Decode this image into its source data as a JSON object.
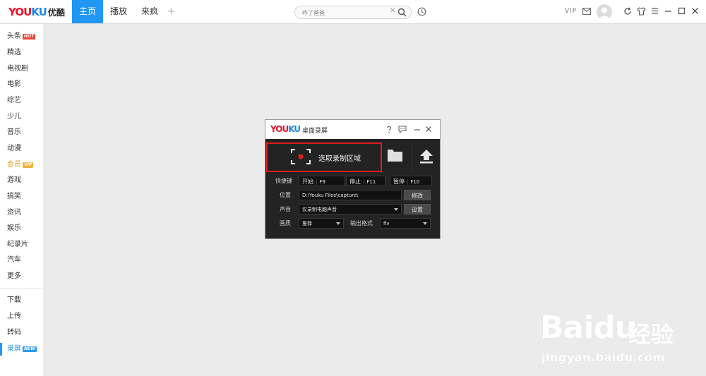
{
  "brand": {
    "logo_word": "YOUKU",
    "logo_cn": "优酷",
    "accent": "#2196f3",
    "logo_red": "#e8132b",
    "logo_blue": "#1e88e5"
  },
  "topnav": {
    "tabs": [
      {
        "label": "主页",
        "active": true
      },
      {
        "label": "播放",
        "active": false
      },
      {
        "label": "来疯",
        "active": false
      }
    ],
    "plus": "+"
  },
  "search": {
    "placeholder": "咋了爸爸",
    "clear": "✕",
    "icon": "search-icon"
  },
  "header_right": {
    "vip": "VIP",
    "icons": [
      "history-icon",
      "mail-icon",
      "avatar",
      "refresh-icon",
      "skin-icon",
      "menu-icon",
      "minimize-icon",
      "maximize-icon",
      "close-icon"
    ]
  },
  "sidebar": {
    "items": [
      {
        "label": "头条",
        "badge": "HOT"
      },
      {
        "label": "精选"
      },
      {
        "label": "电视剧"
      },
      {
        "label": "电影"
      },
      {
        "label": "综艺"
      },
      {
        "label": "少儿"
      },
      {
        "label": "音乐"
      },
      {
        "label": "动漫"
      },
      {
        "label": "会员",
        "badge": "VIP"
      },
      {
        "label": "游戏"
      },
      {
        "label": "搞笑"
      },
      {
        "label": "资讯"
      },
      {
        "label": "娱乐"
      },
      {
        "label": "纪录片"
      },
      {
        "label": "汽车"
      },
      {
        "label": "更多"
      }
    ],
    "tools": [
      {
        "label": "下载"
      },
      {
        "label": "上传"
      },
      {
        "label": "转码"
      },
      {
        "label": "录屏",
        "badge": "NEW",
        "active": true
      }
    ]
  },
  "recorder": {
    "logo_word": "YOUKU",
    "title": "桌面录屏",
    "select_area": "选取录制区域",
    "hotkeys": {
      "label": "快捷键",
      "start_label": "开始",
      "start_key": "F9",
      "stop_label": "停止",
      "stop_key": "F11",
      "pause_label": "暂停",
      "pause_key": "F10"
    },
    "location": {
      "label": "位置",
      "value": "D:\\Youku Files\\capture\\",
      "button": "修改"
    },
    "audio": {
      "label": "声音",
      "value": "仅录制电脑声音",
      "button": "设置"
    },
    "quality": {
      "label": "画质",
      "value": "推荐",
      "format_label": "输出格式",
      "format_value": "flv"
    }
  },
  "watermark": {
    "text": "Bai",
    "paw": "du",
    "cn": "经验",
    "url": "jingyan.baidu.com"
  }
}
